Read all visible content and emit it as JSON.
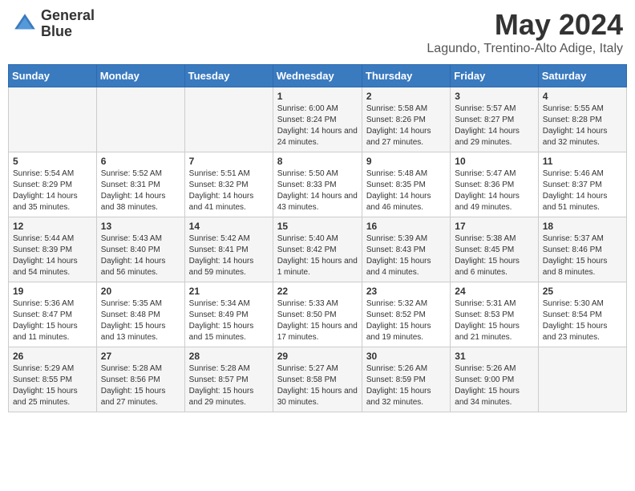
{
  "logo": {
    "line1": "General",
    "line2": "Blue"
  },
  "title": "May 2024",
  "location": "Lagundo, Trentino-Alto Adige, Italy",
  "weekdays": [
    "Sunday",
    "Monday",
    "Tuesday",
    "Wednesday",
    "Thursday",
    "Friday",
    "Saturday"
  ],
  "weeks": [
    [
      {
        "day": "",
        "info": ""
      },
      {
        "day": "",
        "info": ""
      },
      {
        "day": "",
        "info": ""
      },
      {
        "day": "1",
        "info": "Sunrise: 6:00 AM\nSunset: 8:24 PM\nDaylight: 14 hours and 24 minutes."
      },
      {
        "day": "2",
        "info": "Sunrise: 5:58 AM\nSunset: 8:26 PM\nDaylight: 14 hours and 27 minutes."
      },
      {
        "day": "3",
        "info": "Sunrise: 5:57 AM\nSunset: 8:27 PM\nDaylight: 14 hours and 29 minutes."
      },
      {
        "day": "4",
        "info": "Sunrise: 5:55 AM\nSunset: 8:28 PM\nDaylight: 14 hours and 32 minutes."
      }
    ],
    [
      {
        "day": "5",
        "info": "Sunrise: 5:54 AM\nSunset: 8:29 PM\nDaylight: 14 hours and 35 minutes."
      },
      {
        "day": "6",
        "info": "Sunrise: 5:52 AM\nSunset: 8:31 PM\nDaylight: 14 hours and 38 minutes."
      },
      {
        "day": "7",
        "info": "Sunrise: 5:51 AM\nSunset: 8:32 PM\nDaylight: 14 hours and 41 minutes."
      },
      {
        "day": "8",
        "info": "Sunrise: 5:50 AM\nSunset: 8:33 PM\nDaylight: 14 hours and 43 minutes."
      },
      {
        "day": "9",
        "info": "Sunrise: 5:48 AM\nSunset: 8:35 PM\nDaylight: 14 hours and 46 minutes."
      },
      {
        "day": "10",
        "info": "Sunrise: 5:47 AM\nSunset: 8:36 PM\nDaylight: 14 hours and 49 minutes."
      },
      {
        "day": "11",
        "info": "Sunrise: 5:46 AM\nSunset: 8:37 PM\nDaylight: 14 hours and 51 minutes."
      }
    ],
    [
      {
        "day": "12",
        "info": "Sunrise: 5:44 AM\nSunset: 8:39 PM\nDaylight: 14 hours and 54 minutes."
      },
      {
        "day": "13",
        "info": "Sunrise: 5:43 AM\nSunset: 8:40 PM\nDaylight: 14 hours and 56 minutes."
      },
      {
        "day": "14",
        "info": "Sunrise: 5:42 AM\nSunset: 8:41 PM\nDaylight: 14 hours and 59 minutes."
      },
      {
        "day": "15",
        "info": "Sunrise: 5:40 AM\nSunset: 8:42 PM\nDaylight: 15 hours and 1 minute."
      },
      {
        "day": "16",
        "info": "Sunrise: 5:39 AM\nSunset: 8:43 PM\nDaylight: 15 hours and 4 minutes."
      },
      {
        "day": "17",
        "info": "Sunrise: 5:38 AM\nSunset: 8:45 PM\nDaylight: 15 hours and 6 minutes."
      },
      {
        "day": "18",
        "info": "Sunrise: 5:37 AM\nSunset: 8:46 PM\nDaylight: 15 hours and 8 minutes."
      }
    ],
    [
      {
        "day": "19",
        "info": "Sunrise: 5:36 AM\nSunset: 8:47 PM\nDaylight: 15 hours and 11 minutes."
      },
      {
        "day": "20",
        "info": "Sunrise: 5:35 AM\nSunset: 8:48 PM\nDaylight: 15 hours and 13 minutes."
      },
      {
        "day": "21",
        "info": "Sunrise: 5:34 AM\nSunset: 8:49 PM\nDaylight: 15 hours and 15 minutes."
      },
      {
        "day": "22",
        "info": "Sunrise: 5:33 AM\nSunset: 8:50 PM\nDaylight: 15 hours and 17 minutes."
      },
      {
        "day": "23",
        "info": "Sunrise: 5:32 AM\nSunset: 8:52 PM\nDaylight: 15 hours and 19 minutes."
      },
      {
        "day": "24",
        "info": "Sunrise: 5:31 AM\nSunset: 8:53 PM\nDaylight: 15 hours and 21 minutes."
      },
      {
        "day": "25",
        "info": "Sunrise: 5:30 AM\nSunset: 8:54 PM\nDaylight: 15 hours and 23 minutes."
      }
    ],
    [
      {
        "day": "26",
        "info": "Sunrise: 5:29 AM\nSunset: 8:55 PM\nDaylight: 15 hours and 25 minutes."
      },
      {
        "day": "27",
        "info": "Sunrise: 5:28 AM\nSunset: 8:56 PM\nDaylight: 15 hours and 27 minutes."
      },
      {
        "day": "28",
        "info": "Sunrise: 5:28 AM\nSunset: 8:57 PM\nDaylight: 15 hours and 29 minutes."
      },
      {
        "day": "29",
        "info": "Sunrise: 5:27 AM\nSunset: 8:58 PM\nDaylight: 15 hours and 30 minutes."
      },
      {
        "day": "30",
        "info": "Sunrise: 5:26 AM\nSunset: 8:59 PM\nDaylight: 15 hours and 32 minutes."
      },
      {
        "day": "31",
        "info": "Sunrise: 5:26 AM\nSunset: 9:00 PM\nDaylight: 15 hours and 34 minutes."
      },
      {
        "day": "",
        "info": ""
      }
    ]
  ]
}
